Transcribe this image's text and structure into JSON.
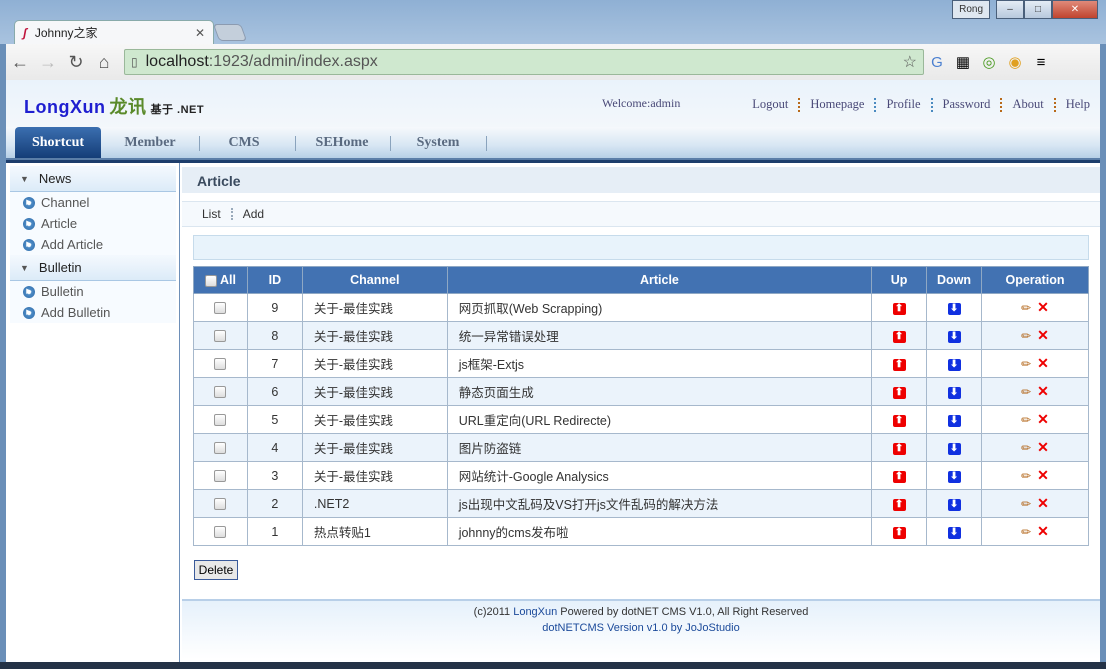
{
  "browser": {
    "tab_title": "Johnny之家",
    "user": "Rong",
    "url_host": "localhost",
    "url_path": ":1923/admin/index.aspx"
  },
  "header": {
    "logo_en": "LongXun",
    "logo_cn": "龙讯",
    "logo_sub": "基于 .NET",
    "welcome": "Welcome:admin",
    "links": [
      "Logout",
      "Homepage",
      "Profile",
      "Password",
      "About",
      "Help"
    ]
  },
  "nav": {
    "tabs": [
      "Shortcut",
      "Member",
      "CMS",
      "SEHome",
      "System"
    ],
    "active": "Shortcut"
  },
  "sidebar": {
    "groups": [
      {
        "title": "News",
        "items": [
          "Channel",
          "Article",
          "Add Article"
        ]
      },
      {
        "title": "Bulletin",
        "items": [
          "Bulletin",
          "Add Bulletin"
        ]
      }
    ]
  },
  "main": {
    "title": "Article",
    "subnav": [
      "List",
      "Add"
    ],
    "columns": [
      "All",
      "ID",
      "Channel",
      "Article",
      "Up",
      "Down",
      "Operation"
    ],
    "rows": [
      {
        "id": "9",
        "channel": "关于-最佳实践",
        "article": "网页抓取(Web Scrapping)"
      },
      {
        "id": "8",
        "channel": "关于-最佳实践",
        "article": "统一异常错误处理"
      },
      {
        "id": "7",
        "channel": "关于-最佳实践",
        "article": "js框架-Extjs"
      },
      {
        "id": "6",
        "channel": "关于-最佳实践",
        "article": "静态页面生成"
      },
      {
        "id": "5",
        "channel": "关于-最佳实践",
        "article": "URL重定向(URL Redirecte)"
      },
      {
        "id": "4",
        "channel": "关于-最佳实践",
        "article": "图片防盗链"
      },
      {
        "id": "3",
        "channel": "关于-最佳实践",
        "article": "网站统计-Google Analysics"
      },
      {
        "id": "2",
        "channel": ".NET2",
        "article": "js出现中文乱码及VS打开js文件乱码的解决方法"
      },
      {
        "id": "1",
        "channel": "热点转贴1",
        "article": "johnny的cms发布啦"
      }
    ],
    "delete_label": "Delete"
  },
  "footer": {
    "line1_a": "(c)2011 ",
    "line1_b": "LongXun",
    "line1_c": " Powered by dotNET CMS V1.0, All Right Reserved",
    "line2": "dotNETCMS Version v1.0 by JoJoStudio"
  }
}
